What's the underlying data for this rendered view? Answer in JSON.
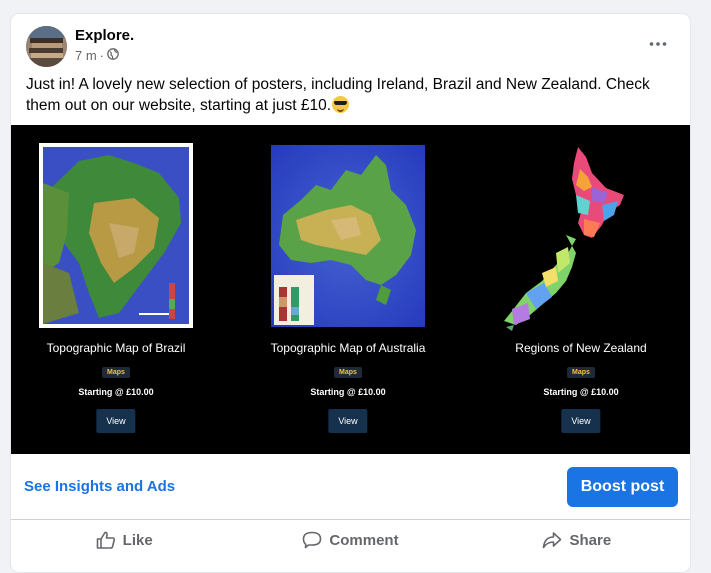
{
  "post": {
    "page_name": "Explore.",
    "time": "7 m",
    "separator": "·",
    "text": "Just in! A lovely new selection of posters, including Ireland, Brazil and New Zealand.  Check them out on our website, starting at just £10.",
    "more_icon": "more-horizontal-icon",
    "audience_icon": "globe-icon"
  },
  "posters": [
    {
      "title": "Topographic Map of Brazil",
      "tag": "Maps",
      "price": "Starting @ £10.00",
      "button": "View"
    },
    {
      "title": "Topographic Map of Australia",
      "tag": "Maps",
      "price": "Starting @ £10.00",
      "button": "View"
    },
    {
      "title": "Regions of New Zealand",
      "tag": "Maps",
      "price": "Starting @ £10.00",
      "button": "View"
    }
  ],
  "insights": {
    "link": "See Insights and Ads",
    "boost": "Boost post"
  },
  "actions": [
    {
      "label": "Like",
      "icon": "thumbs-up-icon"
    },
    {
      "label": "Comment",
      "icon": "comment-icon"
    },
    {
      "label": "Share",
      "icon": "share-icon"
    }
  ],
  "colors": {
    "accent": "#1b74e4",
    "secondary_text": "#65676b",
    "background": "#f0f2f5",
    "tag_text": "#f3c14a",
    "view_button": "#15314d"
  }
}
